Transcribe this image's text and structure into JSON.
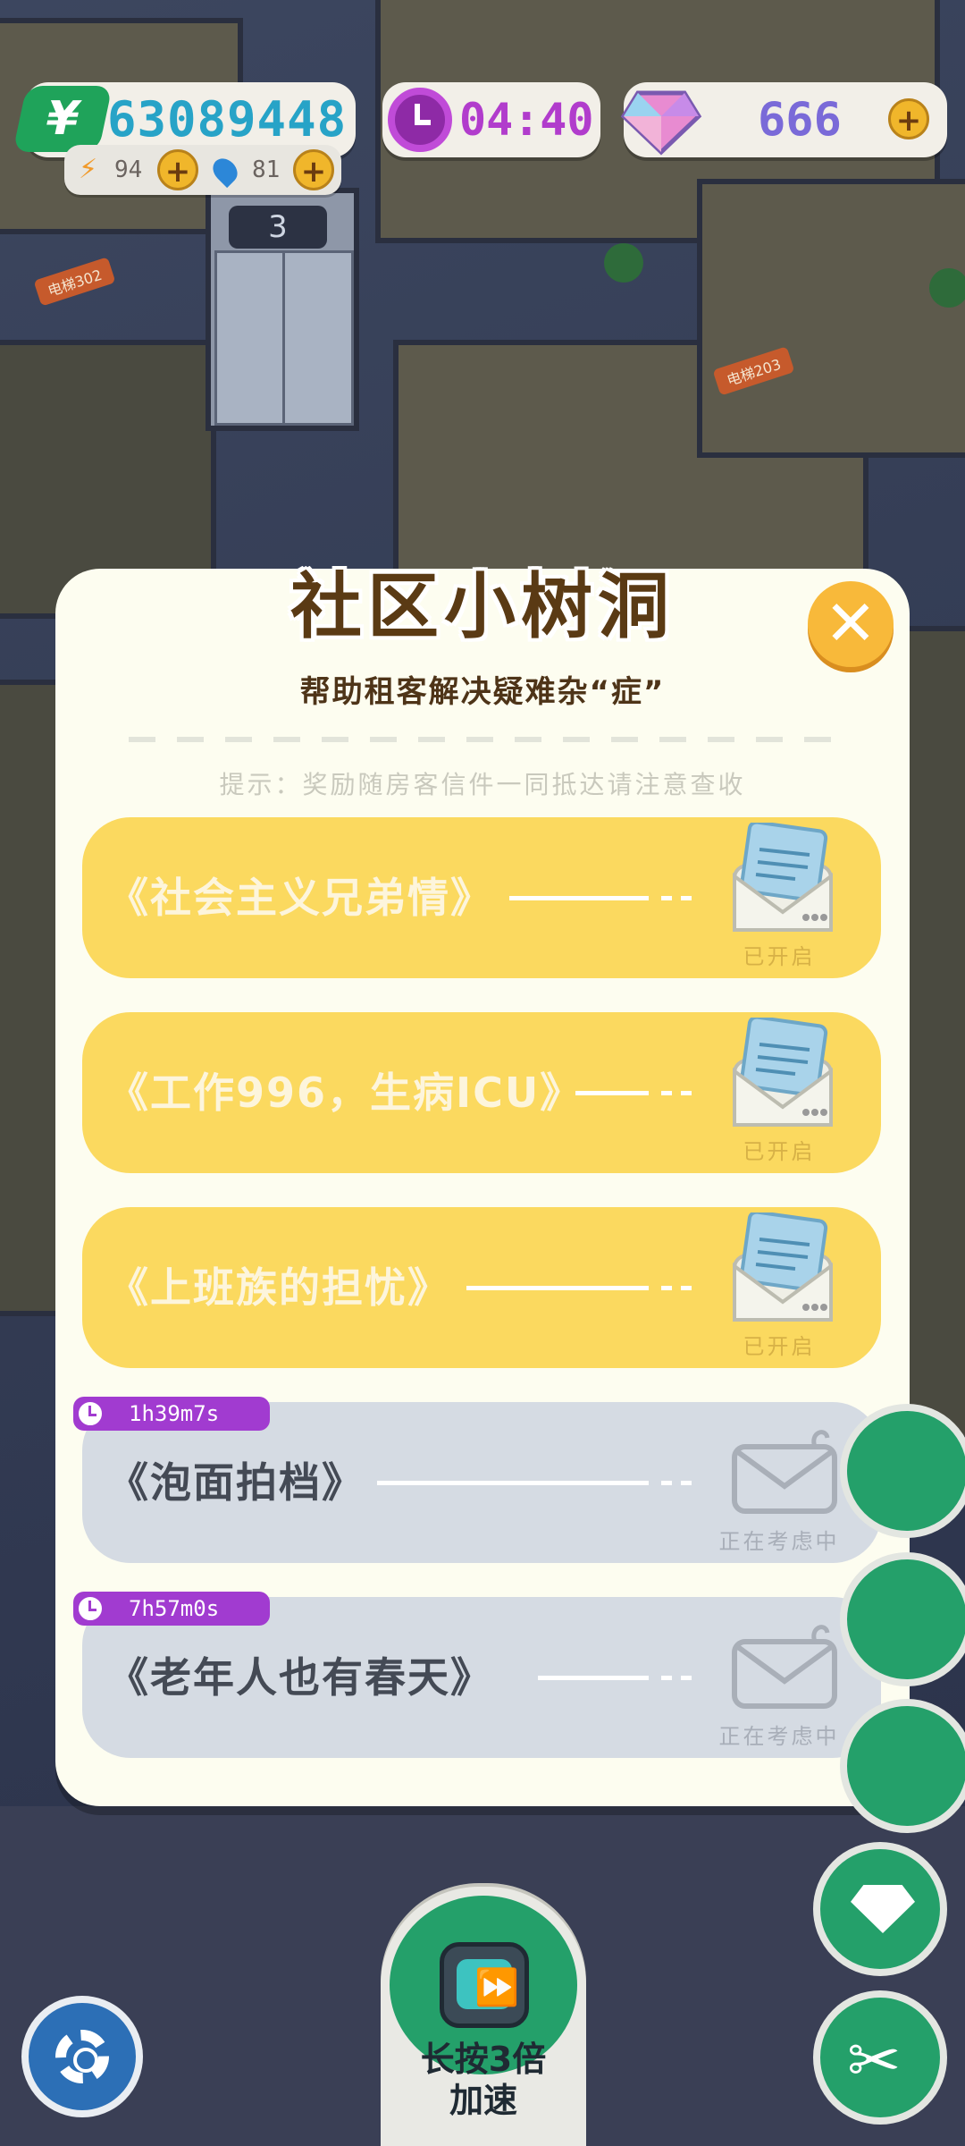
{
  "hud": {
    "money": "63089448",
    "energy": "94",
    "water": "81",
    "time": "04:40",
    "gems": "666",
    "money_symbol": "¥",
    "plus": "+"
  },
  "scene_labels": {
    "elevator_number": "3",
    "tag_left": "电梯302",
    "tag_right": "电梯203"
  },
  "modal": {
    "title": "社区小树洞",
    "close": "✕",
    "subtitle": "帮助租客解决疑难杂“症”",
    "hint": "提示：奖励随房客信件一同抵达请注意查收",
    "letters": [
      {
        "title": "《社会主义兄弟情》",
        "status": "已开启",
        "state": "open"
      },
      {
        "title": "《工作996，生病ICU》",
        "status": "已开启",
        "state": "open"
      },
      {
        "title": "《上班族的担忧》",
        "status": "已开启",
        "state": "open"
      },
      {
        "title": "《泡面拍档》",
        "status": "正在考虑中",
        "state": "pending",
        "timer": "1h39m7s"
      },
      {
        "title": "《老年人也有春天》",
        "status": "正在考虑中",
        "state": "pending",
        "timer": "7h57m0s"
      }
    ]
  },
  "bottom": {
    "speed_label_line1": "长按3倍",
    "speed_label_line2": "加速",
    "tools_glyph": "✂"
  },
  "colors": {
    "modal_bg": "#fdfdf0",
    "open_row": "#fbd95f",
    "pending_row": "#d5dbe3",
    "timer_badge": "#a13bd0",
    "close_btn": "#f8b93a"
  }
}
